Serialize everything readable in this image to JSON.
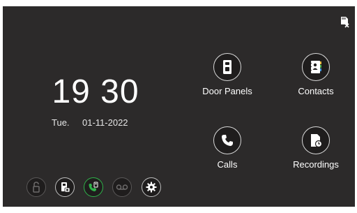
{
  "clock": {
    "time": "19 30",
    "day": "Tue.",
    "date": "01-11-2022"
  },
  "apps": [
    {
      "label": "Door Panels",
      "icon": "door-panel-icon"
    },
    {
      "label": "Contacts",
      "icon": "contacts-book-icon"
    },
    {
      "label": "Calls",
      "icon": "phone-icon"
    },
    {
      "label": "Recordings",
      "icon": "recordings-icon"
    }
  ],
  "quick_actions": [
    {
      "icon": "unlock-icon",
      "state": "disabled"
    },
    {
      "icon": "snapshot-icon",
      "state": "normal"
    },
    {
      "icon": "monitor-call-icon",
      "state": "active"
    },
    {
      "icon": "voicemail-icon",
      "state": "disabled"
    },
    {
      "icon": "settings-gear-icon",
      "state": "normal"
    }
  ],
  "status": {
    "sd_card": "sd-card-missing-icon"
  },
  "colors": {
    "background": "#2c2a2a",
    "accent_green": "#2fb34a",
    "text": "#ffffff"
  }
}
